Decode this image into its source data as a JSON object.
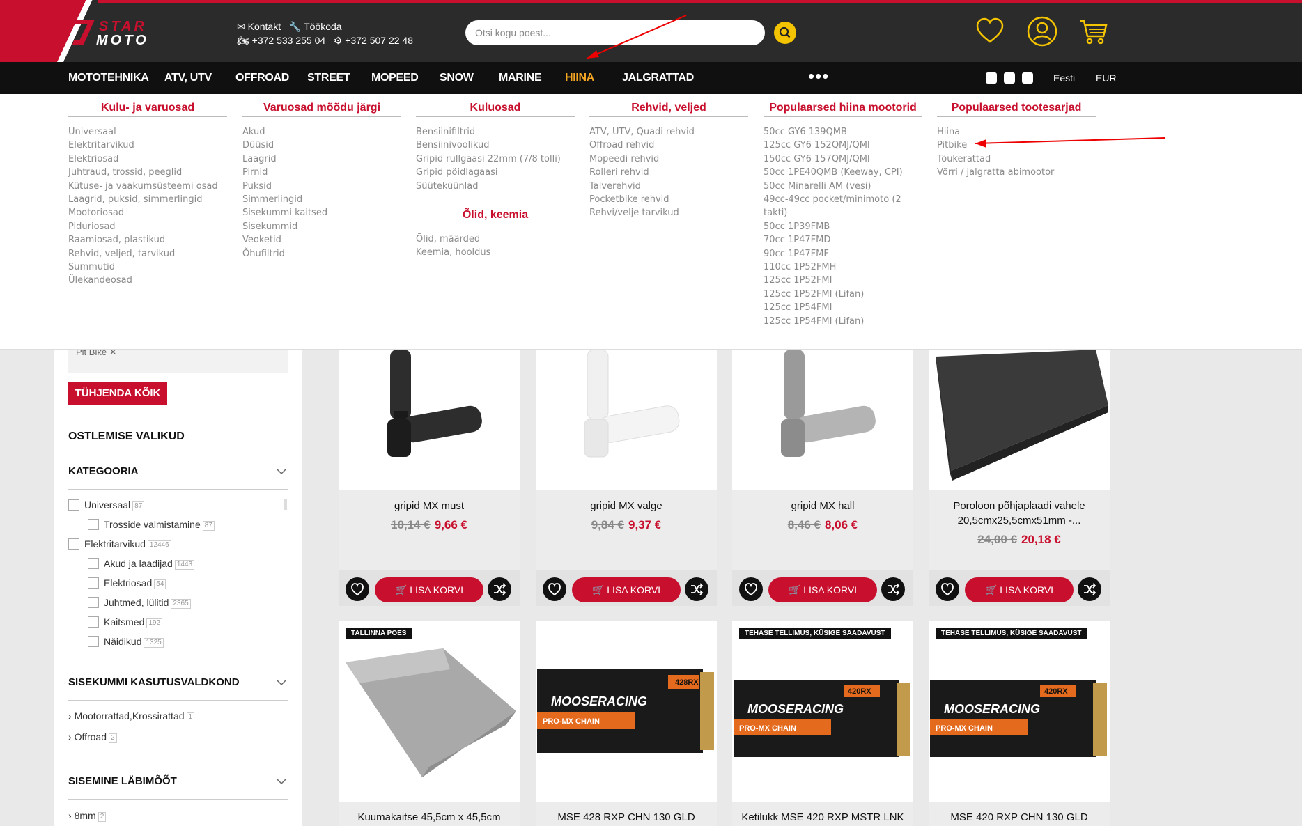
{
  "header": {
    "contact_label": "Kontakt",
    "tools_label": "Töökoda",
    "phone1": "+372 533 255 04",
    "phone2": "+372 507 22 48",
    "search_placeholder": "Otsi kogu poest..."
  },
  "nav": {
    "items": [
      "MOTOTEHNIKA",
      "ATV, UTV",
      "OFFROAD",
      "STREET",
      "MOPEED",
      "SNOW",
      "MARINE",
      "HIINA",
      "JALGRATTAD"
    ],
    "active": "HIINA",
    "more": "•••",
    "language": "Eesti",
    "currency": "EUR"
  },
  "mega_menu": {
    "columns": [
      {
        "title": "Kulu- ja varuosad",
        "links": [
          "Universaal",
          "Elektritarvikud",
          "Elektriosad",
          "Juhtraud, trossid, peeglid",
          "Kütuse- ja vaakumsüsteemi osad",
          "Laagrid, puksid, simmerlingid",
          "Mootoriosad",
          "Piduriosad",
          "Raamiosad, plastikud",
          "Rehvid, veljed, tarvikud",
          "Summutid",
          "Ülekandeosad"
        ]
      },
      {
        "title": "Varuosad mõõdu järgi",
        "links": [
          "Akud",
          "Düüsid",
          "Laagrid",
          "Pirnid",
          "Puksid",
          "Simmerlingid",
          "Sisekummi kaitsed",
          "Sisekummid",
          "Veoketid",
          "Õhufiltrid"
        ]
      },
      {
        "title": "Kuluosad",
        "links": [
          "Bensiinifiltrid",
          "Bensiinivoolikud",
          "Gripid rullgaasi 22mm (7/8 tolli)",
          "Gripid pöidlagaasi",
          "Süüteküünlad"
        ]
      },
      {
        "title": "Rehvid, veljed",
        "links": [
          "ATV, UTV, Quadi rehvid",
          "Offroad rehvid",
          "Mopeedi rehvid",
          "Rolleri rehvid",
          "Talverehvid",
          "Pocketbike rehvid",
          "Rehvi/velje tarvikud"
        ]
      },
      {
        "title": "Populaarsed hiina mootorid",
        "links": [
          "50cc GY6 139QMB",
          "125cc GY6 152QMJ/QMI",
          "150cc GY6 157QMJ/QMI",
          "50cc 1PE40QMB (Keeway, CPI)",
          "50cc Minarelli AM (vesi)",
          "49cc-49cc pocket/minimoto (2 takti)",
          "50cc 1P39FMB",
          "70cc 1P47FMD",
          "90cc 1P47FMF",
          "110cc 1P52FMH",
          "125cc 1P52FMI",
          "125cc 1P52FMI (Lifan)",
          "125cc 1P54FMI",
          "125cc 1P54FMI (Lifan)"
        ]
      },
      {
        "title": "Populaarsed tootesarjad",
        "links": [
          "Hiina",
          "Pitbike",
          "Tõukerattad",
          "Võrri / jalgratta abimootor"
        ]
      }
    ],
    "extra": {
      "title": "Õlid, keemia",
      "links": [
        "Õlid, määrded",
        "Keemia, hooldus"
      ]
    }
  },
  "sidebar": {
    "filter_chip": "Pit Bike",
    "clear_all": "TÜHJENDA KÕIK",
    "shopping_options": "OSTLEMISE VALIKUD",
    "category_title": "KATEGOORIA",
    "categories": [
      {
        "label": "Universaal",
        "count": "87"
      },
      {
        "label": "Trosside valmistamine",
        "count": "87"
      },
      {
        "label": "Elektritarvikud",
        "count": "12446"
      },
      {
        "label": "Akud ja laadijad",
        "count": "1443"
      },
      {
        "label": "Elektriosad",
        "count": "54"
      },
      {
        "label": "Juhtmed, lülitid",
        "count": "2365"
      },
      {
        "label": "Kaitsmed",
        "count": "192"
      },
      {
        "label": "Näidikud",
        "count": "1325"
      }
    ],
    "tube_title": "SISEKUMMI KASUTUSVALDKOND",
    "tube_items": [
      {
        "label": "Mootorrattad,Krossirattad",
        "count": "1"
      },
      {
        "label": "Offroad",
        "count": "2"
      }
    ],
    "diameter_title": "SISEMINE LÄBIMÕÕT",
    "diameter_items": [
      {
        "label": "8mm",
        "count": "2"
      }
    ]
  },
  "products": [
    {
      "name": "gripid MX must",
      "old_price": "10,14 €",
      "new_price": "9,66 €",
      "image": "black-grips"
    },
    {
      "name": "gripid MX valge",
      "old_price": "9,84 €",
      "new_price": "9,37 €",
      "image": "white-grips"
    },
    {
      "name": "gripid MX hall",
      "old_price": "8,46 €",
      "new_price": "8,06 €",
      "image": "grey-grips"
    },
    {
      "name": "Poroloon põhjaplaadi vahele 20,5cmx25,5cmx51mm -...",
      "old_price": "24,00 €",
      "new_price": "20,18 €",
      "image": "foam-block"
    },
    {
      "name": "Kuumakaitse 45,5cm x 45,5cm",
      "badge": "TALLINNA POES",
      "image": "heat-shield"
    },
    {
      "name": "MSE 428 RXP CHN 130 GLD",
      "image": "chain-box",
      "box_label": "428RX"
    },
    {
      "name": "Ketilukk MSE 420 RXP MSTR LNK",
      "badge": "TEHASE TELLIMUS, KÜSIGE SAADAVUST",
      "image": "chain-box",
      "box_label": "420RX"
    },
    {
      "name": "MSE 420 RXP CHN 130 GLD",
      "badge": "TEHASE TELLIMUS, KÜSIGE SAADAVUST",
      "image": "chain-box",
      "box_label": "420RX"
    }
  ],
  "product_labels": {
    "add_to_cart": "LISA KORVI"
  },
  "box_text": {
    "brand": "MOOSERACING",
    "line": "PRO-MX CHAIN"
  },
  "colors": {
    "brand_red": "#c8102e",
    "accent_yellow": "#f5c400",
    "active_nav": "#f5a623"
  }
}
